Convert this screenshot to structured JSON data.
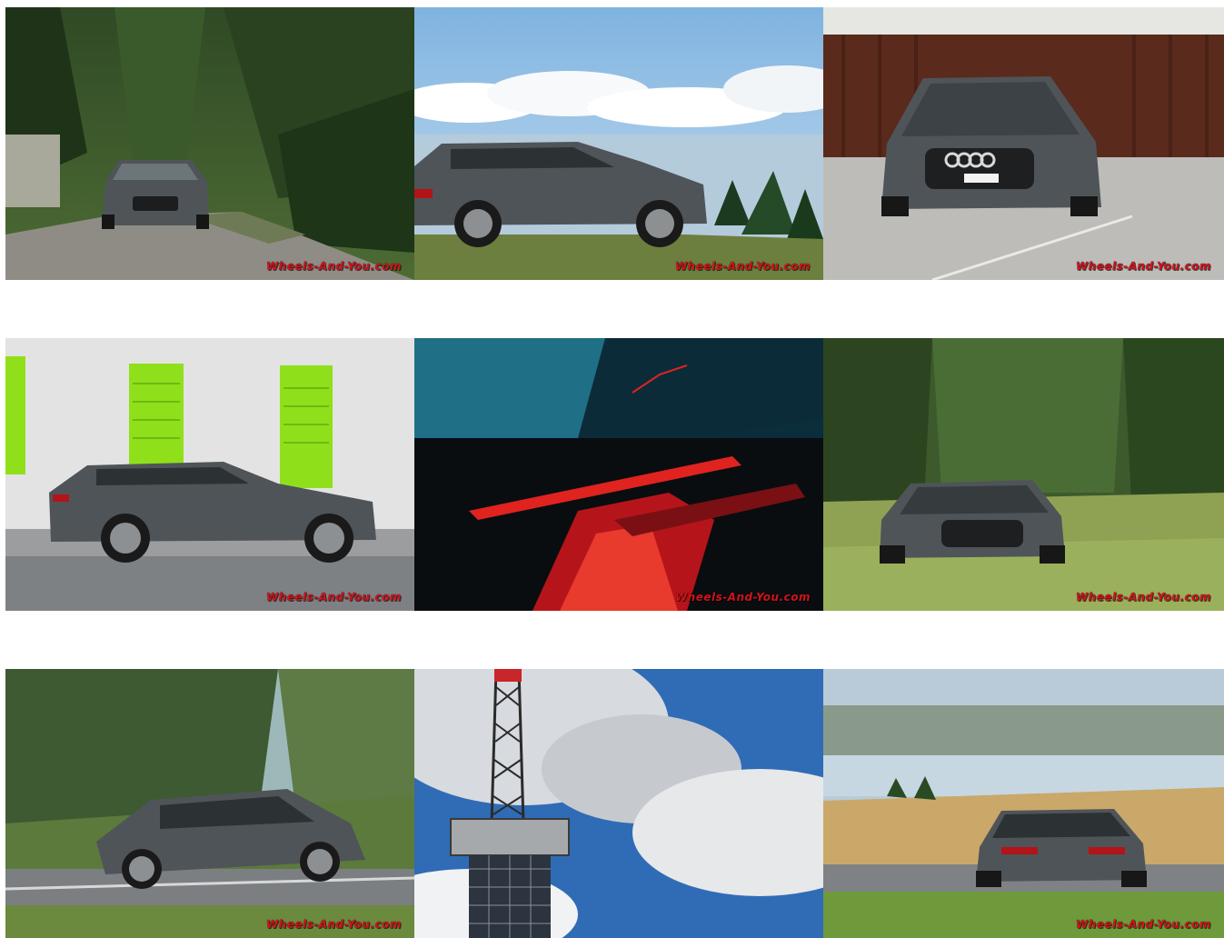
{
  "watermark": "Wheels-And-You.com",
  "colors": {
    "watermark": "#d0141b",
    "car_body": "#4f5458",
    "shutter_green": "#8fe01b",
    "ambient_red": "#e0231f"
  },
  "photos": [
    {
      "id": "p1",
      "scene": "car-on-forest-road-front",
      "icon": "car-photo"
    },
    {
      "id": "p2",
      "scene": "car-side-mountain-sky",
      "icon": "car-photo"
    },
    {
      "id": "p3",
      "scene": "car-front-wooden-barn",
      "icon": "car-photo"
    },
    {
      "id": "p4",
      "scene": "car-side-green-shutters",
      "icon": "car-photo"
    },
    {
      "id": "p5",
      "scene": "interior-red-ambient-light",
      "icon": "interior-photo"
    },
    {
      "id": "p6",
      "scene": "car-front-meadow-trees",
      "icon": "car-photo"
    },
    {
      "id": "p7",
      "scene": "car-driving-motion-blur",
      "icon": "car-photo"
    },
    {
      "id": "p8",
      "scene": "antenna-tower-cloudy-sky",
      "icon": "tower-photo"
    },
    {
      "id": "p9",
      "scene": "car-rear-lake-field",
      "icon": "car-photo"
    }
  ]
}
